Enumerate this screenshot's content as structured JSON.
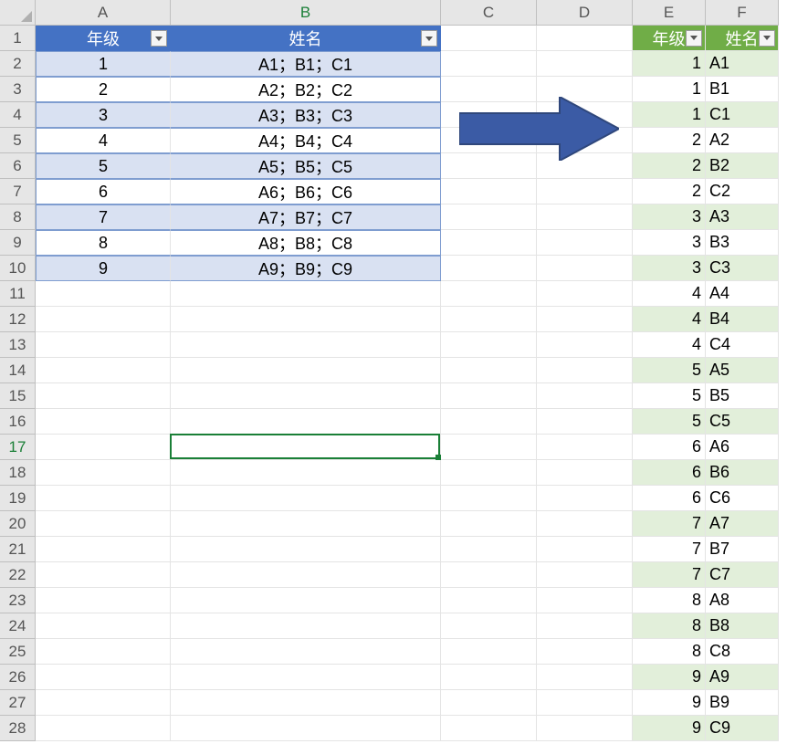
{
  "columns": [
    "A",
    "B",
    "C",
    "D",
    "E",
    "F"
  ],
  "rows": [
    "1",
    "2",
    "3",
    "4",
    "5",
    "6",
    "7",
    "8",
    "9",
    "10",
    "11",
    "12",
    "13",
    "14",
    "15",
    "16",
    "17",
    "18",
    "19",
    "20",
    "21",
    "22",
    "23",
    "24",
    "25",
    "26",
    "27",
    "28"
  ],
  "blueTable": {
    "headers": {
      "grade": "年级",
      "name": "姓名"
    },
    "rows": [
      {
        "grade": "1",
        "name": "A1；B1；C1"
      },
      {
        "grade": "2",
        "name": "A2；B2；C2"
      },
      {
        "grade": "3",
        "name": "A3；B3；C3"
      },
      {
        "grade": "4",
        "name": "A4；B4；C4"
      },
      {
        "grade": "5",
        "name": "A5；B5；C5"
      },
      {
        "grade": "6",
        "name": "A6；B6；C6"
      },
      {
        "grade": "7",
        "name": "A7；B7；C7"
      },
      {
        "grade": "8",
        "name": "A8；B8；C8"
      },
      {
        "grade": "9",
        "name": "A9；B9；C9"
      }
    ]
  },
  "greenTable": {
    "headers": {
      "grade": "年级",
      "name": "姓名"
    },
    "rows": [
      {
        "grade": "1",
        "name": "A1"
      },
      {
        "grade": "1",
        "name": "B1"
      },
      {
        "grade": "1",
        "name": "C1"
      },
      {
        "grade": "2",
        "name": "A2"
      },
      {
        "grade": "2",
        "name": "B2"
      },
      {
        "grade": "2",
        "name": "C2"
      },
      {
        "grade": "3",
        "name": "A3"
      },
      {
        "grade": "3",
        "name": "B3"
      },
      {
        "grade": "3",
        "name": "C3"
      },
      {
        "grade": "4",
        "name": "A4"
      },
      {
        "grade": "4",
        "name": "B4"
      },
      {
        "grade": "4",
        "name": "C4"
      },
      {
        "grade": "5",
        "name": "A5"
      },
      {
        "grade": "5",
        "name": "B5"
      },
      {
        "grade": "5",
        "name": "C5"
      },
      {
        "grade": "6",
        "name": "A6"
      },
      {
        "grade": "6",
        "name": "B6"
      },
      {
        "grade": "6",
        "name": "C6"
      },
      {
        "grade": "7",
        "name": "A7"
      },
      {
        "grade": "7",
        "name": "B7"
      },
      {
        "grade": "7",
        "name": "C7"
      },
      {
        "grade": "8",
        "name": "A8"
      },
      {
        "grade": "8",
        "name": "B8"
      },
      {
        "grade": "8",
        "name": "C8"
      },
      {
        "grade": "9",
        "name": "A9"
      },
      {
        "grade": "9",
        "name": "B9"
      },
      {
        "grade": "9",
        "name": "C9"
      }
    ]
  },
  "activeCell": "B17",
  "arrowColor": "#3b5ba5"
}
